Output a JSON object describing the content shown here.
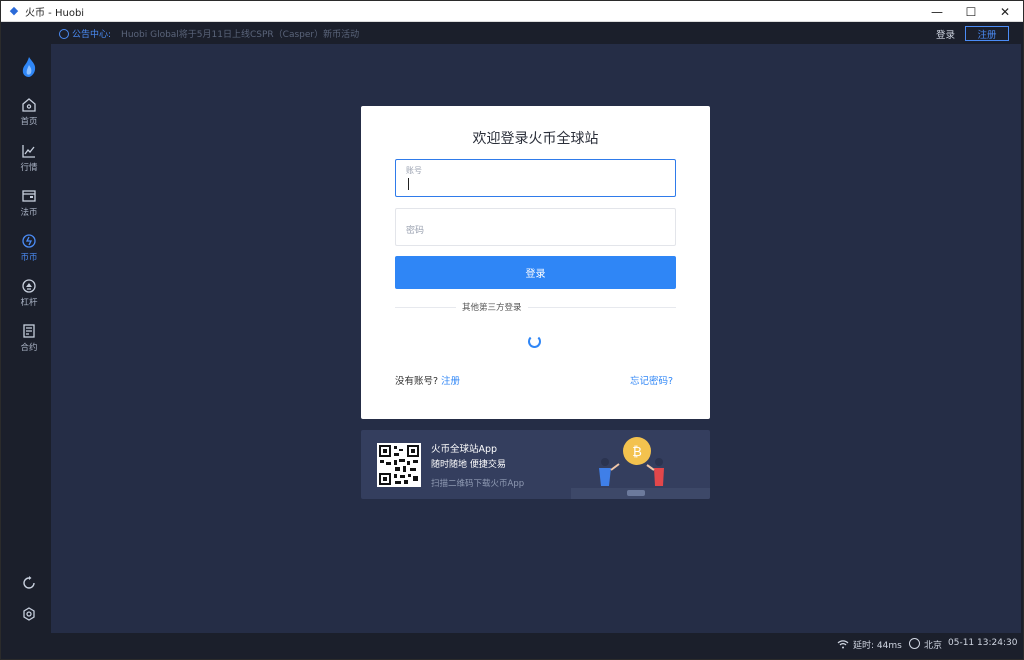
{
  "window": {
    "title": "火币 - Huobi",
    "minimize": "—",
    "maximize": "☐",
    "close": "✕"
  },
  "topbar": {
    "announcement_label": "公告中心:",
    "announcement_text": "Huobi Global将于5月11日上线CSPR（Casper）新币活动",
    "login": "登录",
    "register": "注册"
  },
  "sidebar": {
    "items": [
      {
        "label": "首页",
        "icon": "home-icon"
      },
      {
        "label": "行情",
        "icon": "chart-icon"
      },
      {
        "label": "法币",
        "icon": "wallet-icon"
      },
      {
        "label": "币币",
        "icon": "coin-icon"
      },
      {
        "label": "杠杆",
        "icon": "leverage-icon"
      },
      {
        "label": "合约",
        "icon": "contract-icon"
      }
    ],
    "active_index": 3
  },
  "login": {
    "title": "欢迎登录火币全球站",
    "account_label": "账号",
    "password_label": "密码",
    "login_button": "登录",
    "third_party": "其他第三方登录",
    "no_account": "没有账号?",
    "register_link": "注册",
    "forgot": "忘记密码?"
  },
  "app_banner": {
    "title": "火币全球站App",
    "subtitle": "随时随地 便捷交易",
    "hint": "扫描二维码下载火币App"
  },
  "status": {
    "delay": "延时: 44ms",
    "city": "北京",
    "time": "05-11 13:24:30"
  },
  "colors": {
    "accent": "#2f86f6",
    "sidebar": "#1b1f2b",
    "main": "#252d46"
  }
}
